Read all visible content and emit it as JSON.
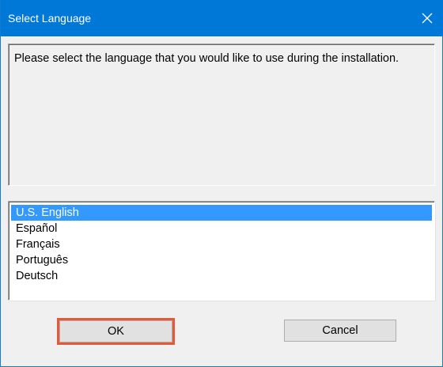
{
  "window": {
    "title": "Select Language",
    "close_icon": "close-icon"
  },
  "message": "Please select the language that you would like to use during the installation.",
  "languages": [
    {
      "label": "U.S. English",
      "selected": true
    },
    {
      "label": "Español",
      "selected": false
    },
    {
      "label": "Français",
      "selected": false
    },
    {
      "label": "Português",
      "selected": false
    },
    {
      "label": "Deutsch",
      "selected": false
    }
  ],
  "buttons": {
    "ok_label": "OK",
    "cancel_label": "Cancel"
  },
  "colors": {
    "titlebar": "#0078d7",
    "selection": "#3399ff",
    "ok_highlight": "#e55a36"
  }
}
